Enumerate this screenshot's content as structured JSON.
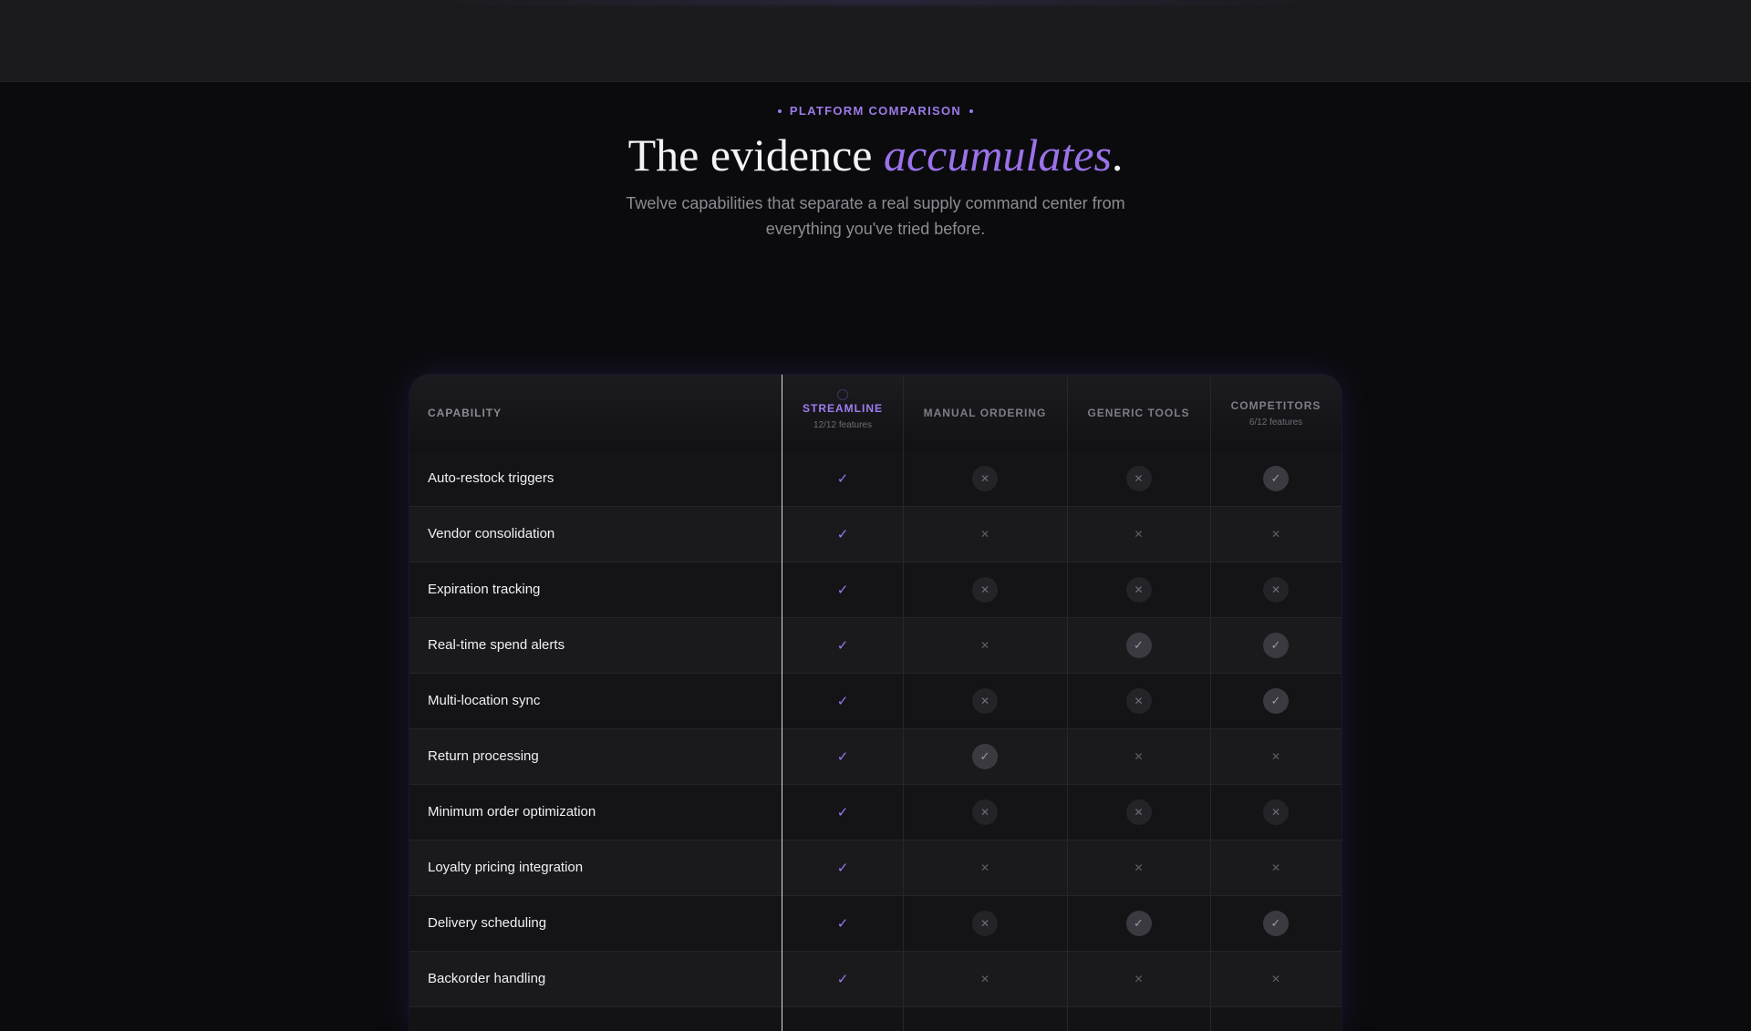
{
  "header": {
    "eyebrow": "PLATFORM COMPARISON",
    "title_plain": "The evidence ",
    "title_accent": "accumulates",
    "title_period": ".",
    "subtitle": "Twelve capabilities that separate a real supply command center from everything you've tried before."
  },
  "table": {
    "columns": [
      {
        "label": "CAPABILITY",
        "sub": ""
      },
      {
        "label": "STREAMLINE",
        "sub": "12/12 features"
      },
      {
        "label": "MANUAL ORDERING",
        "sub": ""
      },
      {
        "label": "GENERIC TOOLS",
        "sub": ""
      },
      {
        "label": "COMPETITORS",
        "sub": "6/12 features"
      }
    ],
    "rows": [
      {
        "name": "Auto-restock triggers",
        "marks": [
          "check",
          "circle-x",
          "circle-x",
          "circle-check"
        ]
      },
      {
        "name": "Vendor consolidation",
        "marks": [
          "check",
          "x",
          "x",
          "x"
        ]
      },
      {
        "name": "Expiration tracking",
        "marks": [
          "check",
          "circle-x",
          "circle-x",
          "circle-x"
        ]
      },
      {
        "name": "Real-time spend alerts",
        "marks": [
          "check",
          "x",
          "circle-check",
          "circle-check"
        ]
      },
      {
        "name": "Multi-location sync",
        "marks": [
          "check",
          "circle-x",
          "circle-x",
          "circle-check"
        ]
      },
      {
        "name": "Return processing",
        "marks": [
          "check",
          "circle-check",
          "x",
          "x"
        ]
      },
      {
        "name": "Minimum order optimization",
        "marks": [
          "check",
          "circle-x",
          "circle-x",
          "circle-x"
        ]
      },
      {
        "name": "Loyalty pricing integration",
        "marks": [
          "check",
          "x",
          "x",
          "x"
        ]
      },
      {
        "name": "Delivery scheduling",
        "marks": [
          "check",
          "circle-x",
          "circle-check",
          "circle-check"
        ]
      },
      {
        "name": "Backorder handling",
        "marks": [
          "check",
          "x",
          "x",
          "x"
        ]
      }
    ]
  },
  "icons": {
    "check": "check-icon",
    "x": "x-icon",
    "circle-check": "check-circle-icon",
    "circle-x": "x-circle-icon"
  },
  "colors": {
    "accent": "#9c7bea",
    "background": "#0b0b0d"
  }
}
